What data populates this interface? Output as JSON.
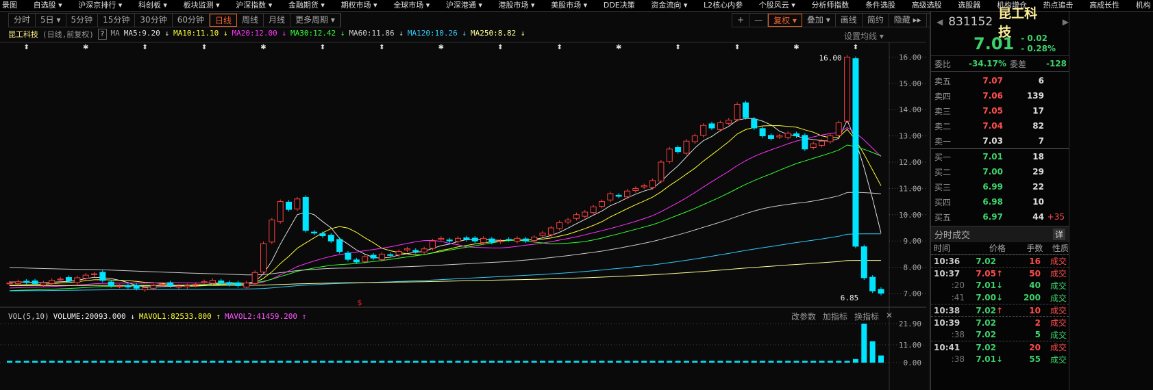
{
  "menu": [
    "景图",
    "自选股 ▾",
    "沪深京排行 ▾",
    "科创板 ▾",
    "板块监测 ▾",
    "沪深指数 ▾",
    "金融期货 ▾",
    "期权市场 ▾",
    "全球市场 ▾",
    "沪深港通 ▾",
    "港股市场 ▾",
    "美股市场 ▾",
    "DDE决策",
    "资金流向 ▾",
    "L2核心内参",
    "个股风云 ▾",
    "分析师指数",
    "条件选股",
    "高级选股",
    "选股器",
    "机构增仓",
    "热点追击",
    "高成长性",
    "机构"
  ],
  "periods": [
    "分时",
    "5日 ▾",
    "5分钟",
    "15分钟",
    "30分钟",
    "60分钟",
    "日线",
    "周线",
    "月线",
    "更多周期 ▾"
  ],
  "active_period": "日线",
  "tools": [
    "+",
    "—",
    "复权 ▾",
    "叠加 ▾",
    "画线",
    "简约",
    "隐藏 ▸▸",
    "⤢"
  ],
  "active_tool": "复权 ▾",
  "title": {
    "name": "昆工科技",
    "mode": "(日线,前复权)",
    "help": "?",
    "ma": "MA"
  },
  "ma_labels": [
    {
      "text": "MA5:9.20 ↓",
      "color": "#e0e0e0"
    },
    {
      "text": "MA10:11.10 ↓",
      "color": "#ffff33"
    },
    {
      "text": "MA20:12.00 ↓",
      "color": "#ff33ff"
    },
    {
      "text": "MA30:12.42 ↓",
      "color": "#33ff33"
    },
    {
      "text": "MA60:11.86 ↓",
      "color": "#cccccc"
    },
    {
      "text": "MA120:10.26 ↓",
      "color": "#33ccff"
    },
    {
      "text": "MA250:8.82 ↓",
      "color": "#ffff99"
    }
  ],
  "set_ma": "设置均线 ▾",
  "vol": {
    "name": "VOL(5,10)",
    "volume": "VOLUME:20093.000 ↓",
    "mavol1": "MAVOL1:82533.800 ↑",
    "mavol2": "MAVOL2:41459.200 ↑",
    "tools": [
      "改参数",
      "加指标",
      "换指标",
      "✕"
    ],
    "axis": [
      "21.90",
      "11.00",
      "0.00"
    ],
    "values": [
      1,
      1,
      1,
      1,
      1,
      1,
      1,
      1,
      1,
      1,
      1,
      1,
      1,
      1,
      1,
      1,
      1,
      1,
      1,
      1,
      1,
      1,
      1,
      1,
      1,
      1,
      1,
      1,
      1,
      1,
      1,
      1,
      1,
      1,
      1,
      1,
      1,
      1,
      1,
      1,
      1,
      1,
      1,
      1,
      1,
      1,
      1,
      1,
      1,
      1,
      1,
      1,
      1,
      1,
      1,
      1,
      1,
      1,
      1,
      1,
      1,
      1,
      1,
      1,
      1,
      1,
      1,
      1,
      1,
      1,
      1,
      1,
      1,
      1,
      1,
      1,
      1,
      1,
      1,
      1,
      1,
      1,
      1,
      1,
      1,
      1,
      1,
      1,
      1,
      1,
      1,
      1,
      1,
      1,
      1,
      1,
      1,
      1,
      1,
      1,
      2,
      21.9,
      12,
      4
    ]
  },
  "chart_data": {
    "type": "candlestick",
    "ylim": [
      6.6,
      16.4
    ],
    "yticks": [
      "16.00",
      "15.00",
      "14.00",
      "13.00",
      "12.00",
      "11.00",
      "10.00",
      "9.00",
      "8.00",
      "7.00"
    ],
    "high_label": "16.00",
    "low_label": "6.85",
    "marker": "$",
    "close": [
      7.4,
      7.45,
      7.42,
      7.38,
      7.4,
      7.5,
      7.55,
      7.48,
      7.6,
      7.7,
      7.75,
      7.5,
      7.3,
      7.28,
      7.25,
      7.2,
      7.22,
      7.3,
      7.35,
      7.3,
      7.28,
      7.3,
      7.35,
      7.45,
      7.5,
      7.4,
      7.35,
      7.3,
      7.4,
      7.8,
      8.9,
      9.8,
      10.5,
      10.2,
      10.6,
      9.4,
      9.3,
      9.2,
      9.0,
      8.6,
      8.3,
      8.2,
      8.4,
      8.35,
      8.5,
      8.45,
      8.6,
      8.7,
      8.6,
      8.7,
      9.0,
      9.1,
      9.0,
      9.1,
      9.05,
      9.0,
      9.1,
      8.95,
      9.0,
      9.05,
      9.1,
      9.0,
      9.15,
      9.3,
      9.5,
      9.7,
      9.8,
      10.0,
      10.1,
      10.3,
      10.5,
      10.8,
      10.7,
      10.9,
      11.0,
      11.1,
      11.3,
      12.0,
      12.5,
      12.4,
      12.8,
      13.0,
      13.4,
      13.3,
      13.5,
      13.6,
      14.2,
      13.7,
      13.3,
      13.0,
      12.9,
      13.0,
      13.1,
      13.0,
      12.5,
      12.7,
      12.8,
      13.0,
      13.5,
      16.0,
      8.8,
      7.6,
      7.1,
      7.01
    ]
  },
  "quote": {
    "code": "831152",
    "name": "昆工科技",
    "price": "7.01",
    "change": "- 0.02",
    "pct": "- 0.28%",
    "wb_label": "委比",
    "wb": "-34.17%",
    "wc_label": "委差",
    "wc": "-128",
    "asks": [
      {
        "l": "卖五",
        "p": "7.07",
        "v": "6"
      },
      {
        "l": "卖四",
        "p": "7.06",
        "v": "139"
      },
      {
        "l": "卖三",
        "p": "7.05",
        "v": "17"
      },
      {
        "l": "卖二",
        "p": "7.04",
        "v": "82"
      },
      {
        "l": "卖一",
        "p": "7.03",
        "v": "7"
      }
    ],
    "bids": [
      {
        "l": "买一",
        "p": "7.01",
        "v": "18",
        "x": ""
      },
      {
        "l": "买二",
        "p": "7.00",
        "v": "29",
        "x": ""
      },
      {
        "l": "买三",
        "p": "6.99",
        "v": "22",
        "x": ""
      },
      {
        "l": "买四",
        "p": "6.98",
        "v": "10",
        "x": ""
      },
      {
        "l": "买五",
        "p": "6.97",
        "v": "44",
        "x": "+35"
      }
    ]
  },
  "ticks": {
    "title": "分时成交",
    "detail": "详",
    "headers": [
      "时间",
      "价格",
      "手数",
      "性质"
    ],
    "rows": [
      {
        "t": "10:36",
        "p": "7.02",
        "a": "",
        "v": "16",
        "k": "成交",
        "pc": "green",
        "vc": "red"
      },
      {
        "t": "10:37",
        "p": "7.05",
        "a": "↑",
        "v": "50",
        "k": "成交",
        "pc": "red",
        "vc": "red"
      },
      {
        "t": ":20",
        "p": "7.01",
        "a": "↓",
        "v": "40",
        "k": "成交",
        "pc": "green",
        "vc": "green"
      },
      {
        "t": ":41",
        "p": "7.00",
        "a": "↓",
        "v": "200",
        "k": "成交",
        "pc": "green",
        "vc": "green"
      },
      {
        "t": "10:38",
        "p": "7.02",
        "a": "↑",
        "v": "10",
        "k": "成交",
        "pc": "green",
        "vc": "red"
      },
      {
        "t": "10:39",
        "p": "7.02",
        "a": "",
        "v": "2",
        "k": "成交",
        "pc": "green",
        "vc": "red"
      },
      {
        "t": ":38",
        "p": "7.02",
        "a": "",
        "v": "5",
        "k": "成交",
        "pc": "green",
        "vc": "green"
      },
      {
        "t": "10:41",
        "p": "7.02",
        "a": "",
        "v": "20",
        "k": "成交",
        "pc": "green",
        "vc": "red"
      },
      {
        "t": ":38",
        "p": "7.01",
        "a": "↓",
        "v": "55",
        "k": "成交",
        "pc": "green",
        "vc": "green"
      }
    ]
  }
}
